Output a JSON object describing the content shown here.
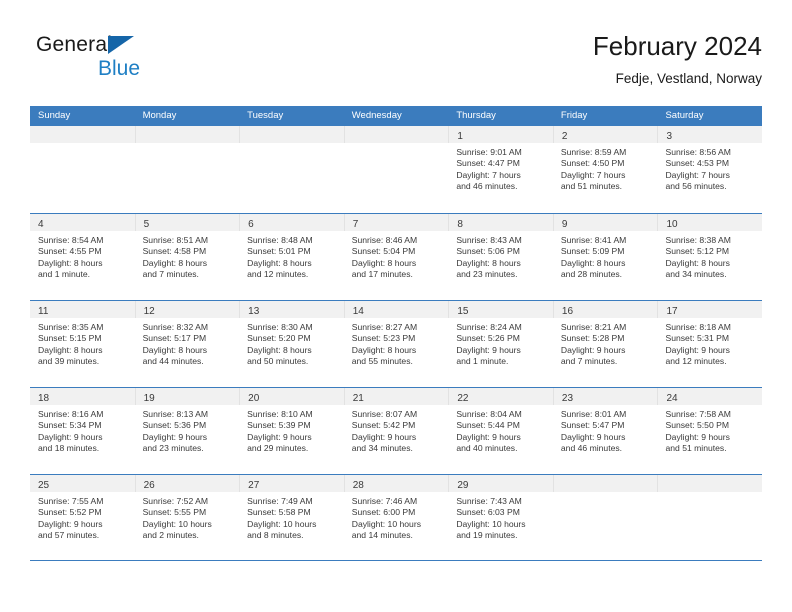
{
  "brand": {
    "name_dark": "General",
    "name_blue": "Blue",
    "accent_color": "#1f7fc4",
    "triangle_color": "#1565a8"
  },
  "header": {
    "title": "February 2024",
    "subtitle": "Fedje, Vestland, Norway"
  },
  "calendar": {
    "header_bg": "#3b7cbe",
    "daynum_bg": "#f1f1f1",
    "weekdays": [
      "Sunday",
      "Monday",
      "Tuesday",
      "Wednesday",
      "Thursday",
      "Friday",
      "Saturday"
    ],
    "weeks": [
      [
        {
          "day": "",
          "lines": []
        },
        {
          "day": "",
          "lines": []
        },
        {
          "day": "",
          "lines": []
        },
        {
          "day": "",
          "lines": []
        },
        {
          "day": "1",
          "lines": [
            "Sunrise: 9:01 AM",
            "Sunset: 4:47 PM",
            "Daylight: 7 hours",
            "and 46 minutes."
          ]
        },
        {
          "day": "2",
          "lines": [
            "Sunrise: 8:59 AM",
            "Sunset: 4:50 PM",
            "Daylight: 7 hours",
            "and 51 minutes."
          ]
        },
        {
          "day": "3",
          "lines": [
            "Sunrise: 8:56 AM",
            "Sunset: 4:53 PM",
            "Daylight: 7 hours",
            "and 56 minutes."
          ]
        }
      ],
      [
        {
          "day": "4",
          "lines": [
            "Sunrise: 8:54 AM",
            "Sunset: 4:55 PM",
            "Daylight: 8 hours",
            "and 1 minute."
          ]
        },
        {
          "day": "5",
          "lines": [
            "Sunrise: 8:51 AM",
            "Sunset: 4:58 PM",
            "Daylight: 8 hours",
            "and 7 minutes."
          ]
        },
        {
          "day": "6",
          "lines": [
            "Sunrise: 8:48 AM",
            "Sunset: 5:01 PM",
            "Daylight: 8 hours",
            "and 12 minutes."
          ]
        },
        {
          "day": "7",
          "lines": [
            "Sunrise: 8:46 AM",
            "Sunset: 5:04 PM",
            "Daylight: 8 hours",
            "and 17 minutes."
          ]
        },
        {
          "day": "8",
          "lines": [
            "Sunrise: 8:43 AM",
            "Sunset: 5:06 PM",
            "Daylight: 8 hours",
            "and 23 minutes."
          ]
        },
        {
          "day": "9",
          "lines": [
            "Sunrise: 8:41 AM",
            "Sunset: 5:09 PM",
            "Daylight: 8 hours",
            "and 28 minutes."
          ]
        },
        {
          "day": "10",
          "lines": [
            "Sunrise: 8:38 AM",
            "Sunset: 5:12 PM",
            "Daylight: 8 hours",
            "and 34 minutes."
          ]
        }
      ],
      [
        {
          "day": "11",
          "lines": [
            "Sunrise: 8:35 AM",
            "Sunset: 5:15 PM",
            "Daylight: 8 hours",
            "and 39 minutes."
          ]
        },
        {
          "day": "12",
          "lines": [
            "Sunrise: 8:32 AM",
            "Sunset: 5:17 PM",
            "Daylight: 8 hours",
            "and 44 minutes."
          ]
        },
        {
          "day": "13",
          "lines": [
            "Sunrise: 8:30 AM",
            "Sunset: 5:20 PM",
            "Daylight: 8 hours",
            "and 50 minutes."
          ]
        },
        {
          "day": "14",
          "lines": [
            "Sunrise: 8:27 AM",
            "Sunset: 5:23 PM",
            "Daylight: 8 hours",
            "and 55 minutes."
          ]
        },
        {
          "day": "15",
          "lines": [
            "Sunrise: 8:24 AM",
            "Sunset: 5:26 PM",
            "Daylight: 9 hours",
            "and 1 minute."
          ]
        },
        {
          "day": "16",
          "lines": [
            "Sunrise: 8:21 AM",
            "Sunset: 5:28 PM",
            "Daylight: 9 hours",
            "and 7 minutes."
          ]
        },
        {
          "day": "17",
          "lines": [
            "Sunrise: 8:18 AM",
            "Sunset: 5:31 PM",
            "Daylight: 9 hours",
            "and 12 minutes."
          ]
        }
      ],
      [
        {
          "day": "18",
          "lines": [
            "Sunrise: 8:16 AM",
            "Sunset: 5:34 PM",
            "Daylight: 9 hours",
            "and 18 minutes."
          ]
        },
        {
          "day": "19",
          "lines": [
            "Sunrise: 8:13 AM",
            "Sunset: 5:36 PM",
            "Daylight: 9 hours",
            "and 23 minutes."
          ]
        },
        {
          "day": "20",
          "lines": [
            "Sunrise: 8:10 AM",
            "Sunset: 5:39 PM",
            "Daylight: 9 hours",
            "and 29 minutes."
          ]
        },
        {
          "day": "21",
          "lines": [
            "Sunrise: 8:07 AM",
            "Sunset: 5:42 PM",
            "Daylight: 9 hours",
            "and 34 minutes."
          ]
        },
        {
          "day": "22",
          "lines": [
            "Sunrise: 8:04 AM",
            "Sunset: 5:44 PM",
            "Daylight: 9 hours",
            "and 40 minutes."
          ]
        },
        {
          "day": "23",
          "lines": [
            "Sunrise: 8:01 AM",
            "Sunset: 5:47 PM",
            "Daylight: 9 hours",
            "and 46 minutes."
          ]
        },
        {
          "day": "24",
          "lines": [
            "Sunrise: 7:58 AM",
            "Sunset: 5:50 PM",
            "Daylight: 9 hours",
            "and 51 minutes."
          ]
        }
      ],
      [
        {
          "day": "25",
          "lines": [
            "Sunrise: 7:55 AM",
            "Sunset: 5:52 PM",
            "Daylight: 9 hours",
            "and 57 minutes."
          ]
        },
        {
          "day": "26",
          "lines": [
            "Sunrise: 7:52 AM",
            "Sunset: 5:55 PM",
            "Daylight: 10 hours",
            "and 2 minutes."
          ]
        },
        {
          "day": "27",
          "lines": [
            "Sunrise: 7:49 AM",
            "Sunset: 5:58 PM",
            "Daylight: 10 hours",
            "and 8 minutes."
          ]
        },
        {
          "day": "28",
          "lines": [
            "Sunrise: 7:46 AM",
            "Sunset: 6:00 PM",
            "Daylight: 10 hours",
            "and 14 minutes."
          ]
        },
        {
          "day": "29",
          "lines": [
            "Sunrise: 7:43 AM",
            "Sunset: 6:03 PM",
            "Daylight: 10 hours",
            "and 19 minutes."
          ]
        },
        {
          "day": "",
          "lines": []
        },
        {
          "day": "",
          "lines": []
        }
      ]
    ]
  }
}
